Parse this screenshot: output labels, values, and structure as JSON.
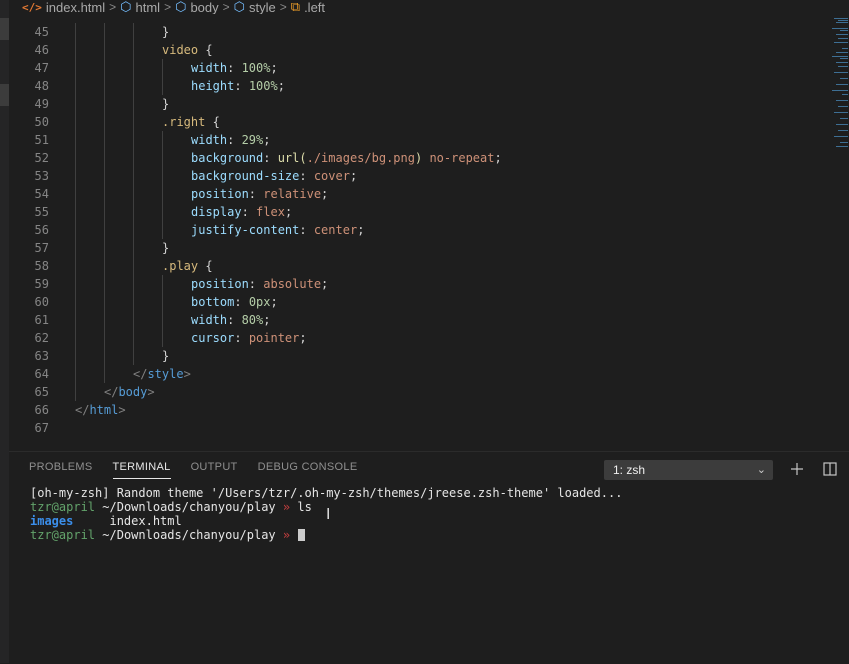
{
  "breadcrumb": {
    "items": [
      {
        "label": "index.html",
        "icon": "html-file-icon"
      },
      {
        "label": "html",
        "icon": "cube-icon"
      },
      {
        "label": "body",
        "icon": "cube-icon"
      },
      {
        "label": "style",
        "icon": "cube-icon"
      },
      {
        "label": ".left",
        "icon": "css-selector-icon"
      }
    ],
    "separator": ">"
  },
  "editor": {
    "lines": [
      {
        "n": "45",
        "indent": 3,
        "tokens": [
          {
            "t": "}",
            "c": "pun"
          }
        ]
      },
      {
        "n": "46",
        "indent": 3,
        "tokens": [
          {
            "t": "video",
            "c": "sel"
          },
          {
            "t": " {",
            "c": "pun"
          }
        ]
      },
      {
        "n": "47",
        "indent": 4,
        "tokens": [
          {
            "t": "width",
            "c": "prop"
          },
          {
            "t": ": ",
            "c": "pun"
          },
          {
            "t": "100%",
            "c": "num"
          },
          {
            "t": ";",
            "c": "pun"
          }
        ]
      },
      {
        "n": "48",
        "indent": 4,
        "tokens": [
          {
            "t": "height",
            "c": "prop"
          },
          {
            "t": ": ",
            "c": "pun"
          },
          {
            "t": "100%",
            "c": "num"
          },
          {
            "t": ";",
            "c": "pun"
          }
        ]
      },
      {
        "n": "49",
        "indent": 3,
        "tokens": [
          {
            "t": "}",
            "c": "pun"
          }
        ]
      },
      {
        "n": "50",
        "indent": 3,
        "tokens": [
          {
            "t": ".right",
            "c": "sel"
          },
          {
            "t": " {",
            "c": "pun"
          }
        ]
      },
      {
        "n": "51",
        "indent": 4,
        "tokens": [
          {
            "t": "width",
            "c": "prop"
          },
          {
            "t": ": ",
            "c": "pun"
          },
          {
            "t": "29%",
            "c": "num"
          },
          {
            "t": ";",
            "c": "pun"
          }
        ]
      },
      {
        "n": "52",
        "indent": 4,
        "tokens": [
          {
            "t": "background",
            "c": "prop"
          },
          {
            "t": ": ",
            "c": "pun"
          },
          {
            "t": "url(",
            "c": "fn"
          },
          {
            "t": "./images/bg.png",
            "c": "val"
          },
          {
            "t": ")",
            "c": "fn"
          },
          {
            "t": " no-repeat",
            "c": "val"
          },
          {
            "t": ";",
            "c": "pun"
          }
        ]
      },
      {
        "n": "53",
        "indent": 4,
        "tokens": [
          {
            "t": "background-size",
            "c": "prop"
          },
          {
            "t": ": ",
            "c": "pun"
          },
          {
            "t": "cover",
            "c": "val"
          },
          {
            "t": ";",
            "c": "pun"
          }
        ]
      },
      {
        "n": "54",
        "indent": 4,
        "tokens": [
          {
            "t": "position",
            "c": "prop"
          },
          {
            "t": ": ",
            "c": "pun"
          },
          {
            "t": "relative",
            "c": "val"
          },
          {
            "t": ";",
            "c": "pun"
          }
        ]
      },
      {
        "n": "55",
        "indent": 4,
        "tokens": [
          {
            "t": "display",
            "c": "prop"
          },
          {
            "t": ": ",
            "c": "pun"
          },
          {
            "t": "flex",
            "c": "val"
          },
          {
            "t": ";",
            "c": "pun"
          }
        ]
      },
      {
        "n": "56",
        "indent": 4,
        "tokens": [
          {
            "t": "justify-content",
            "c": "prop"
          },
          {
            "t": ": ",
            "c": "pun"
          },
          {
            "t": "center",
            "c": "val"
          },
          {
            "t": ";",
            "c": "pun"
          }
        ]
      },
      {
        "n": "57",
        "indent": 3,
        "tokens": [
          {
            "t": "}",
            "c": "pun"
          }
        ]
      },
      {
        "n": "58",
        "indent": 3,
        "tokens": [
          {
            "t": ".play",
            "c": "sel"
          },
          {
            "t": " {",
            "c": "pun"
          }
        ]
      },
      {
        "n": "59",
        "indent": 4,
        "tokens": [
          {
            "t": "position",
            "c": "prop"
          },
          {
            "t": ": ",
            "c": "pun"
          },
          {
            "t": "absolute",
            "c": "val"
          },
          {
            "t": ";",
            "c": "pun"
          }
        ]
      },
      {
        "n": "60",
        "indent": 4,
        "tokens": [
          {
            "t": "bottom",
            "c": "prop"
          },
          {
            "t": ": ",
            "c": "pun"
          },
          {
            "t": "0px",
            "c": "num"
          },
          {
            "t": ";",
            "c": "pun"
          }
        ]
      },
      {
        "n": "61",
        "indent": 4,
        "tokens": [
          {
            "t": "width",
            "c": "prop"
          },
          {
            "t": ": ",
            "c": "pun"
          },
          {
            "t": "80%",
            "c": "num"
          },
          {
            "t": ";",
            "c": "pun"
          }
        ]
      },
      {
        "n": "62",
        "indent": 4,
        "tokens": [
          {
            "t": "cursor",
            "c": "prop"
          },
          {
            "t": ": ",
            "c": "pun"
          },
          {
            "t": "pointer",
            "c": "val"
          },
          {
            "t": ";",
            "c": "pun"
          }
        ]
      },
      {
        "n": "63",
        "indent": 3,
        "tokens": [
          {
            "t": "}",
            "c": "pun"
          }
        ]
      },
      {
        "n": "64",
        "indent": 2,
        "tokens": [
          {
            "t": "</",
            "c": "ang"
          },
          {
            "t": "style",
            "c": "tag"
          },
          {
            "t": ">",
            "c": "ang"
          }
        ]
      },
      {
        "n": "65",
        "indent": 1,
        "tokens": [
          {
            "t": "</",
            "c": "ang"
          },
          {
            "t": "body",
            "c": "tag"
          },
          {
            "t": ">",
            "c": "ang"
          }
        ]
      },
      {
        "n": "66",
        "indent": 0,
        "tokens": [
          {
            "t": "</",
            "c": "ang"
          },
          {
            "t": "html",
            "c": "tag"
          },
          {
            "t": ">",
            "c": "ang"
          }
        ]
      },
      {
        "n": "67",
        "indent": 0,
        "tokens": []
      }
    ]
  },
  "panel": {
    "tabs": [
      {
        "label": "PROBLEMS",
        "active": false
      },
      {
        "label": "TERMINAL",
        "active": true
      },
      {
        "label": "OUTPUT",
        "active": false
      },
      {
        "label": "DEBUG CONSOLE",
        "active": false
      }
    ],
    "terminal_select": "1: zsh",
    "new_terminal_icon": "plus-icon",
    "split_terminal_icon": "split-icon"
  },
  "terminal": {
    "line1": "[oh-my-zsh] Random theme '/Users/tzr/.oh-my-zsh/themes/jreese.zsh-theme' loaded...",
    "prompt_user": "tzr@april",
    "prompt_path": "~/Downloads/chanyou/play",
    "prompt_arrow": "»",
    "command1": "ls",
    "ls_dir": "images",
    "ls_file": "index.html"
  },
  "colors": {
    "background": "#1e1e1e",
    "selector": "#d7ba7d",
    "property": "#9cdcfe",
    "number": "#b5cea8",
    "string": "#ce9178",
    "tag": "#569cd6",
    "prompt_user": "#63a36b",
    "prompt_arrow": "#c33f3f",
    "directory": "#3b8eea"
  }
}
